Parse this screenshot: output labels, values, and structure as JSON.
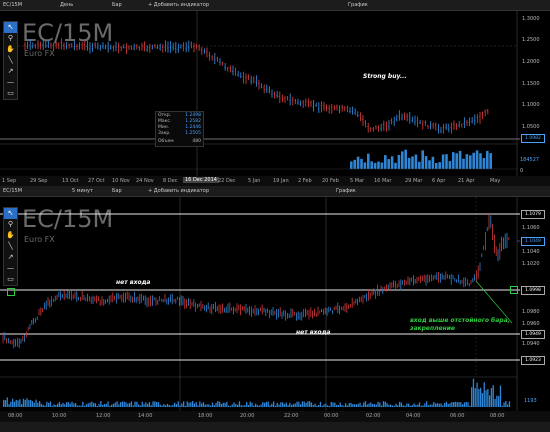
{
  "top": {
    "toolbar": {
      "symbol": "EC/15M",
      "timeframe": "День",
      "chart_type": "Бар",
      "add_indicator": "+ Добавить индикатор",
      "title": "График"
    },
    "watermark": {
      "symbol": "EC/15M",
      "name": "Euro FX"
    },
    "ohlc": {
      "open_label": "Откр.",
      "open": "1.2498",
      "high_label": "Макс.",
      "high": "1.2582",
      "low_label": "Мин.",
      "low": "1.2446",
      "close_label": "Закр.",
      "close": "1.2505",
      "volume_label": "Объем",
      "volume": "480"
    },
    "annotation": "Strong buy...",
    "price_ticks": [
      "1.3000",
      "1.2500",
      "1.2000",
      "1.1500",
      "1.1000",
      "1.0500"
    ],
    "current_price": "1.0982",
    "volume_ticks": [
      "184527",
      "0"
    ],
    "date_ticks": [
      "1 Sep",
      "29 Sep",
      "13 Oct",
      "27 Oct",
      "10 Nov",
      "24 Nov",
      "8 Dec",
      "16 Dec 2014",
      "22 Dec",
      "5 Jan",
      "19 Jan",
      "2 Feb",
      "20 Feb",
      "5 Mar",
      "16 Mar",
      "29 Mar",
      "6 Apr",
      "21 Apr",
      "May"
    ],
    "highlighted_date": "16 Dec 2014"
  },
  "bottom": {
    "toolbar": {
      "symbol": "EC/15M",
      "timeframe": "5 минут",
      "chart_type": "Бар",
      "add_indicator": "+ Добавить индикатор",
      "title": "График"
    },
    "watermark": {
      "symbol": "EC/15M",
      "name": "Euro FX"
    },
    "annotations": {
      "no_entry_1": "нет входа",
      "no_entry_2": "нет входа",
      "entry": "вход выше отстойного бара, закрепление"
    },
    "level_labels": [
      "1.1079",
      "1.0998",
      "1.0949",
      "1.0923"
    ],
    "price_ticks": [
      "1.1060",
      "1.1040",
      "1.1020",
      "1.0980",
      "1.0960",
      "1.0940"
    ],
    "current_price": "1.1049",
    "volume_tick": "1193",
    "time_ticks": [
      "08:00",
      "10:00",
      "12:00",
      "14:00",
      "18:00",
      "20:00",
      "22:00",
      "00:00",
      "02:00",
      "04:00",
      "06:00",
      "08:00"
    ]
  },
  "tools": [
    "pointer-tool",
    "zoom-tool",
    "hand-tool",
    "line-tool",
    "ray-tool",
    "horizontal-line-tool",
    "rectangle-tool"
  ],
  "colors": {
    "bull": "#2f86d6",
    "bear": "#d23a3a",
    "volume": "#2f86d6",
    "annotation_green": "#2ecc40"
  }
}
